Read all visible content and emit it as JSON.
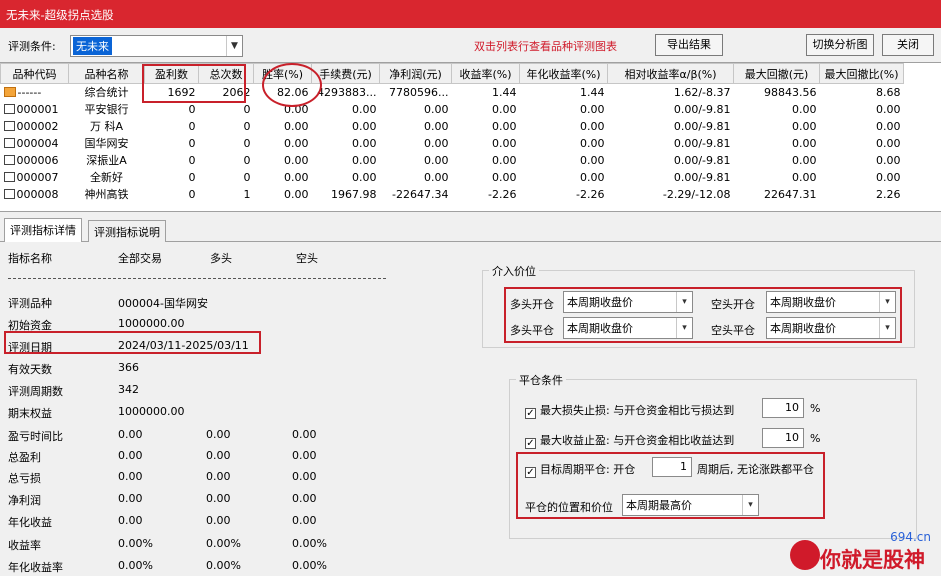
{
  "title": "无未来-超级拐点选股",
  "toolbar": {
    "condition_label": "评测条件:",
    "condition_value": "无未来",
    "hint": "双击列表行查看品种评测图表",
    "export_label": "导出结果",
    "switch_label": "切换分析图",
    "close_label": "关闭"
  },
  "grid": {
    "columns": [
      "品种代码",
      "品种名称",
      "盈利数",
      "总次数",
      "胜率(%)",
      "手续费(元)",
      "净利润(元)",
      "收益率(%)",
      "年化收益率(%)",
      "相对收益率α/β(%)",
      "最大回撤(元)",
      "最大回撤比(%)"
    ],
    "rows": [
      [
        "------",
        "综合统计",
        "1692",
        "2062",
        "82.06",
        "4293883...",
        "7780596...",
        "1.44",
        "1.44",
        "1.62/-8.37",
        "98843.56",
        "8.68"
      ],
      [
        "000001",
        "平安银行",
        "0",
        "0",
        "0.00",
        "0.00",
        "0.00",
        "0.00",
        "0.00",
        "0.00/-9.81",
        "0.00",
        "0.00"
      ],
      [
        "000002",
        "万 科A",
        "0",
        "0",
        "0.00",
        "0.00",
        "0.00",
        "0.00",
        "0.00",
        "0.00/-9.81",
        "0.00",
        "0.00"
      ],
      [
        "000004",
        "国华网安",
        "0",
        "0",
        "0.00",
        "0.00",
        "0.00",
        "0.00",
        "0.00",
        "0.00/-9.81",
        "0.00",
        "0.00"
      ],
      [
        "000006",
        "深振业A",
        "0",
        "0",
        "0.00",
        "0.00",
        "0.00",
        "0.00",
        "0.00",
        "0.00/-9.81",
        "0.00",
        "0.00"
      ],
      [
        "000007",
        "全新好",
        "0",
        "0",
        "0.00",
        "0.00",
        "0.00",
        "0.00",
        "0.00",
        "0.00/-9.81",
        "0.00",
        "0.00"
      ],
      [
        "000008",
        "神州高铁",
        "0",
        "1",
        "0.00",
        "1967.98",
        "-22647.34",
        "-2.26",
        "-2.26",
        "-2.29/-12.08",
        "22647.31",
        "2.26"
      ]
    ]
  },
  "tabs": [
    "评测指标详情",
    "评测指标说明"
  ],
  "detail": {
    "header": [
      "指标名称",
      "全部交易",
      "多头",
      "空头"
    ],
    "rows": [
      {
        "name": "评测品种",
        "all": "000004-国华网安",
        "long": "",
        "short": ""
      },
      {
        "name": "初始资金",
        "all": "1000000.00",
        "long": "",
        "short": ""
      },
      {
        "name": "评测日期",
        "all": "2024/03/11-2025/03/11",
        "long": "",
        "short": ""
      },
      {
        "name": "有效天数",
        "all": "366",
        "long": "",
        "short": ""
      },
      {
        "name": "评测周期数",
        "all": "342",
        "long": "",
        "short": ""
      },
      {
        "name": "期末权益",
        "all": "1000000.00",
        "long": "",
        "short": ""
      },
      {
        "name": "盈亏时间比",
        "all": "0.00",
        "long": "0.00",
        "short": "0.00"
      },
      {
        "name": "总盈利",
        "all": "0.00",
        "long": "0.00",
        "short": "0.00"
      },
      {
        "name": "总亏损",
        "all": "0.00",
        "long": "0.00",
        "short": "0.00"
      },
      {
        "name": "净利润",
        "all": "0.00",
        "long": "0.00",
        "short": "0.00"
      },
      {
        "name": "年化收益",
        "all": "0.00",
        "long": "0.00",
        "short": "0.00"
      },
      {
        "name": "收益率",
        "all": "0.00%",
        "long": "0.00%",
        "short": "0.00%"
      },
      {
        "name": "年化收益率",
        "all": "0.00%",
        "long": "0.00%",
        "short": "0.00%"
      }
    ]
  },
  "entry": {
    "title": "介入价位",
    "long_open_label": "多头开仓",
    "long_open_value": "本周期收盘价",
    "short_open_label": "空头开仓",
    "short_open_value": "本周期收盘价",
    "long_close_label": "多头平仓",
    "long_close_value": "本周期收盘价",
    "short_close_label": "空头平仓",
    "short_close_value": "本周期收盘价"
  },
  "exit": {
    "title": "平仓条件",
    "stop_loss_label": "最大损失止损: 与开仓资金相比亏损达到",
    "stop_loss_value": "10",
    "take_profit_label": "最大收益止盈: 与开仓资金相比收益达到",
    "take_profit_value": "10",
    "percent": "%",
    "target_label_pre": "目标周期平仓: 开仓",
    "target_value": "1",
    "target_label_post": "周期后, 无论涨跌都平仓",
    "position_label": "平仓的位置和价位",
    "position_value": "本周期最高价"
  },
  "watermark": {
    "url": "694.cn",
    "text": "你就是股神"
  },
  "colors": {
    "title_bar": "#d9262f",
    "highlight": "#c8202a",
    "combo_selected": "#0a64d6"
  }
}
